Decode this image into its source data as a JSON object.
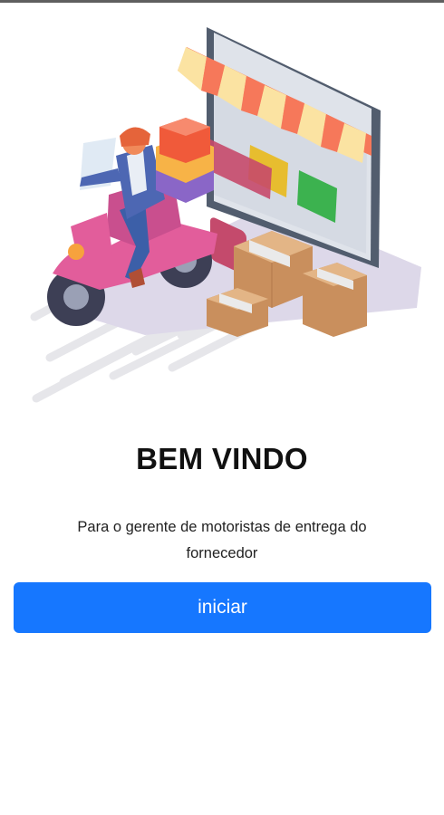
{
  "hero": {
    "image_name": "delivery-scooter-shop-illustration"
  },
  "welcome": {
    "title": "BEM VINDO",
    "subtitle": "Para o gerente de motoristas de entrega do fornecedor"
  },
  "actions": {
    "start_label": "iniciar"
  },
  "colors": {
    "primary_button": "#1677ff",
    "title_text": "#111111",
    "body_text": "#222222"
  }
}
